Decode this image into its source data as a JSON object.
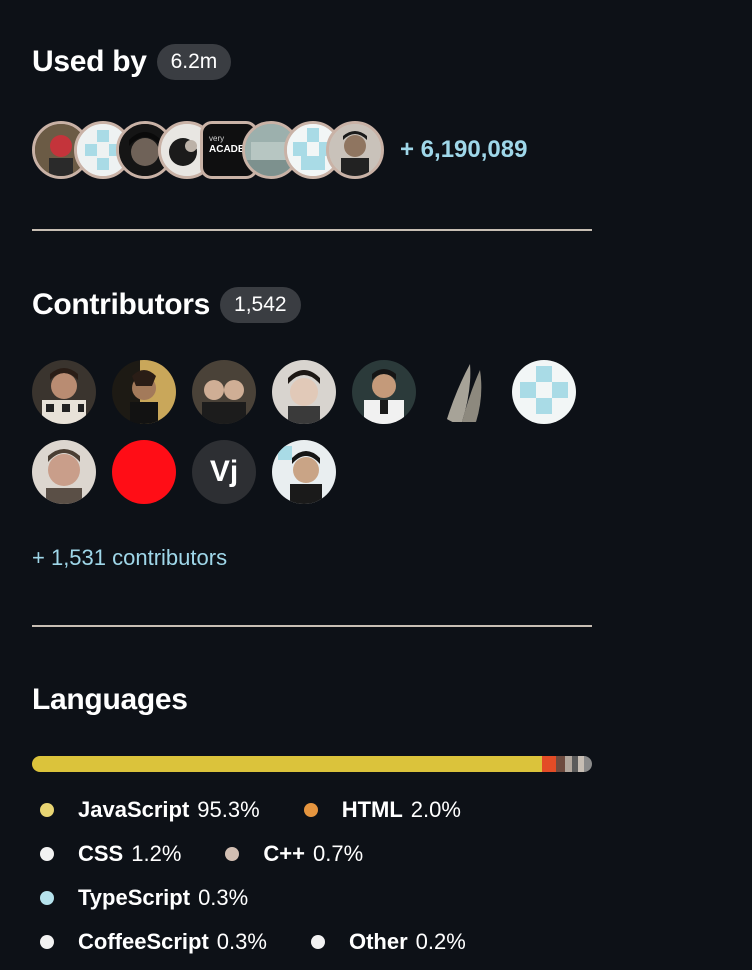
{
  "used_by": {
    "title": "Used by",
    "count_badge": "6.2m",
    "more_label": "+ 6,190,089",
    "avatars": [
      {
        "name": "user-avatar-1"
      },
      {
        "name": "user-avatar-2"
      },
      {
        "name": "user-avatar-3"
      },
      {
        "name": "user-avatar-4"
      },
      {
        "name": "user-avatar-5",
        "text_top": "very",
        "text_main": "ACADEM"
      },
      {
        "name": "user-avatar-6"
      },
      {
        "name": "user-avatar-7"
      },
      {
        "name": "user-avatar-8"
      }
    ]
  },
  "contributors": {
    "title": "Contributors",
    "count_badge": "1,542",
    "more_label": "+ 1,531 contributors",
    "vj_initials": "Vj"
  },
  "languages": {
    "title": "Languages",
    "items": [
      {
        "name": "JavaScript",
        "percent": "95.3%",
        "value": 95.3,
        "color": "#e8d573"
      },
      {
        "name": "HTML",
        "percent": "2.0%",
        "value": 2.0,
        "color": "#e5953f"
      },
      {
        "name": "CSS",
        "percent": "1.2%",
        "value": 1.2,
        "color": "#f2f2f2"
      },
      {
        "name": "C++",
        "percent": "0.7%",
        "value": 0.7,
        "color": "#d2bfb3"
      },
      {
        "name": "TypeScript",
        "percent": "0.3%",
        "value": 0.3,
        "color": "#b5e2ec"
      },
      {
        "name": "CoffeeScript",
        "percent": "0.3%",
        "value": 0.3,
        "color": "#f2f2f2"
      },
      {
        "name": "Other",
        "percent": "0.2%",
        "value": 0.2,
        "color": "#f2f2f2"
      }
    ],
    "bar_colors": {
      "javascript": "#dbc33b",
      "html": "#e34c26",
      "css": "#6e4b3f",
      "cpp": "#f34b7d",
      "typescript": "#3178c6",
      "coffeescript": "#244776",
      "other": "#8b8b8b"
    }
  }
}
